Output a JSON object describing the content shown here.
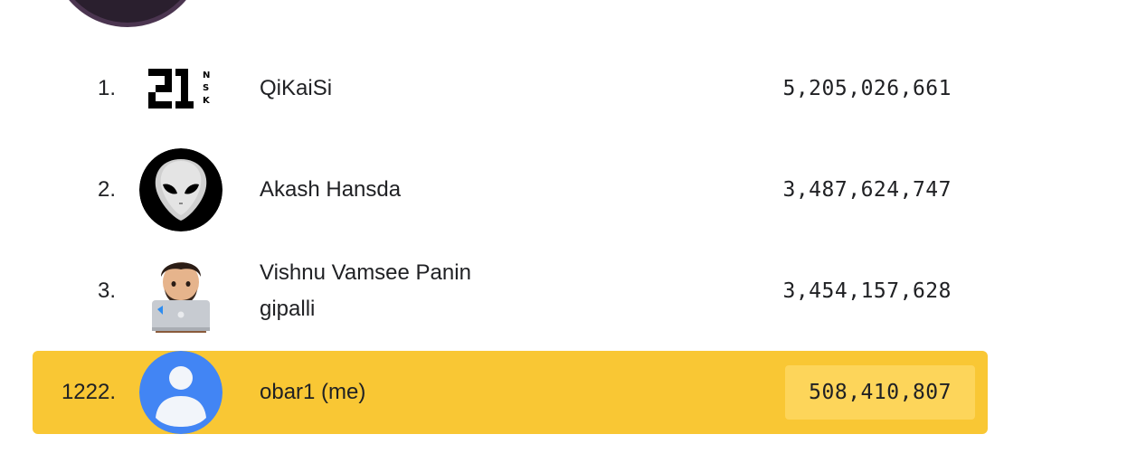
{
  "leaderboard": {
    "rows": [
      {
        "rank": "1.",
        "name": "QiKaiSi",
        "score": "5,205,026,661",
        "avatar": "21-nsk-logo-icon"
      },
      {
        "rank": "2.",
        "name": "Akash Hansda",
        "score": "3,487,624,747",
        "avatar": "alien-face-icon"
      },
      {
        "rank": "3.",
        "name": "Vishnu Vamsee Panin gipalli",
        "score": "3,454,157,628",
        "avatar": "memoji-laptop-icon"
      },
      {
        "rank": "1222.",
        "name": "obar1 (me)",
        "score": "508,410,807",
        "avatar": "default-user-icon",
        "is_me": true
      }
    ]
  },
  "colors": {
    "highlight_row": "#f9c734",
    "highlight_score": "#fdd55a",
    "default_avatar": "#4285f4"
  }
}
